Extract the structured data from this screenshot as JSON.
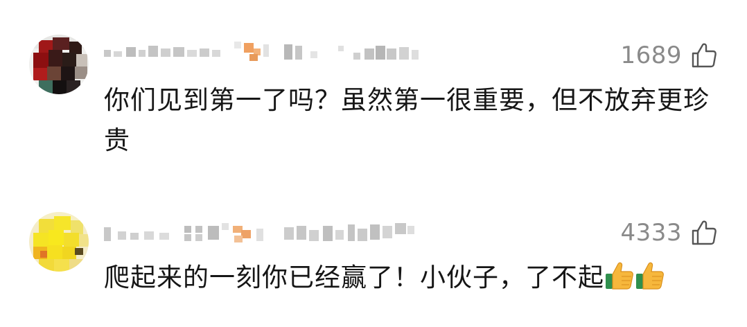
{
  "comments": [
    {
      "username": "",
      "likes": "1689",
      "text": "你们见到第一了吗？虽然第一很重要，但不放弃更珍贵",
      "emoji": "",
      "avatar_icon": "pixelated-avatar-photo",
      "like_icon": "thumbs-up-outline-icon"
    },
    {
      "username": "",
      "likes": "4333",
      "text": "爬起来的一刻你已经赢了！小伙子，了不起",
      "emoji": "👍👍",
      "avatar_icon": "pixelated-avatar-yellow",
      "like_icon": "thumbs-up-outline-icon"
    }
  ],
  "colors": {
    "text": "#161616",
    "like_count": "#8a8a8a",
    "icon_stroke": "#555555",
    "background": "#ffffff"
  }
}
